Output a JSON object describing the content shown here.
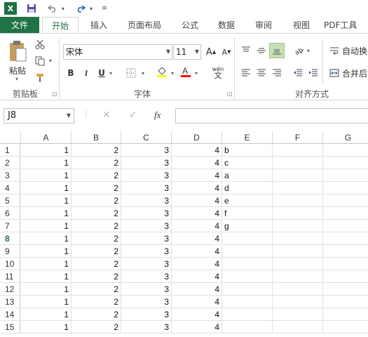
{
  "quick_access": {
    "excel_icon": "X",
    "save_icon": "save-icon",
    "undo_icon": "undo-icon",
    "redo_icon": "redo-icon"
  },
  "tabs": [
    {
      "label": "文件",
      "state": "file"
    },
    {
      "label": "开始",
      "state": "active"
    },
    {
      "label": "插入"
    },
    {
      "label": "页面布局"
    },
    {
      "label": "公式"
    },
    {
      "label": "数据"
    },
    {
      "label": "审阅"
    },
    {
      "label": "视图"
    },
    {
      "label": "PDF工具"
    }
  ],
  "ribbon": {
    "paste_label": "粘贴",
    "clipboard_group": "剪贴板",
    "font_name": "宋体",
    "font_size": "11",
    "bold": "B",
    "italic": "I",
    "underline": "U",
    "font_group": "字体",
    "wen_label": "wén",
    "align_group": "对齐方式",
    "wrap_text": "自动换",
    "merge": "合并后"
  },
  "formula_bar": {
    "name_box": "J8",
    "fx_label": "fx",
    "value": ""
  },
  "columns": [
    "A",
    "B",
    "C",
    "D",
    "E",
    "F",
    "G"
  ],
  "rows": [
    {
      "n": "1",
      "a": "1",
      "b": "2",
      "c": "3",
      "d": "4",
      "e": "b"
    },
    {
      "n": "2",
      "a": "1",
      "b": "2",
      "c": "3",
      "d": "4",
      "e": "c"
    },
    {
      "n": "3",
      "a": "1",
      "b": "2",
      "c": "3",
      "d": "4",
      "e": "a"
    },
    {
      "n": "4",
      "a": "1",
      "b": "2",
      "c": "3",
      "d": "4",
      "e": "d"
    },
    {
      "n": "5",
      "a": "1",
      "b": "2",
      "c": "3",
      "d": "4",
      "e": "e"
    },
    {
      "n": "6",
      "a": "1",
      "b": "2",
      "c": "3",
      "d": "4",
      "e": "f"
    },
    {
      "n": "7",
      "a": "1",
      "b": "2",
      "c": "3",
      "d": "4",
      "e": "g"
    },
    {
      "n": "8",
      "a": "1",
      "b": "2",
      "c": "3",
      "d": "4",
      "e": ""
    },
    {
      "n": "9",
      "a": "1",
      "b": "2",
      "c": "3",
      "d": "4",
      "e": ""
    },
    {
      "n": "10",
      "a": "1",
      "b": "2",
      "c": "3",
      "d": "4",
      "e": ""
    },
    {
      "n": "11",
      "a": "1",
      "b": "2",
      "c": "3",
      "d": "4",
      "e": ""
    },
    {
      "n": "12",
      "a": "1",
      "b": "2",
      "c": "3",
      "d": "4",
      "e": ""
    },
    {
      "n": "13",
      "a": "1",
      "b": "2",
      "c": "3",
      "d": "4",
      "e": ""
    },
    {
      "n": "14",
      "a": "1",
      "b": "2",
      "c": "3",
      "d": "4",
      "e": ""
    },
    {
      "n": "15",
      "a": "1",
      "b": "2",
      "c": "3",
      "d": "4",
      "e": ""
    }
  ],
  "selected_row": "8",
  "colors": {
    "accent": "#217346",
    "highlight": "#ffff00",
    "font_color": "#ff0000"
  }
}
